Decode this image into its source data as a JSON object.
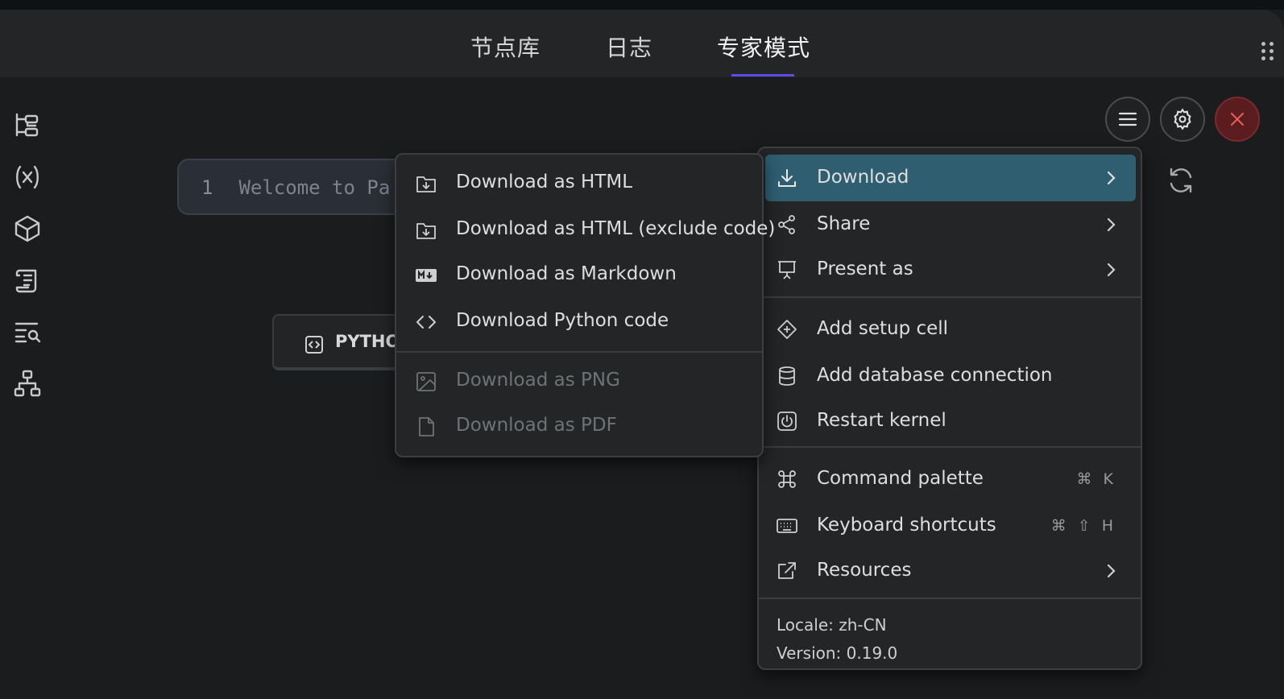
{
  "tabs": [
    {
      "label": "节点库",
      "active": false
    },
    {
      "label": "日志",
      "active": false
    },
    {
      "label": "专家模式",
      "active": true
    }
  ],
  "colors": {
    "accent": "#5b4ee8",
    "highlight": "#2f5e70",
    "close": "#e05a5a"
  },
  "sidebar": {
    "icons": [
      "tree-icon",
      "variables-icon",
      "package-icon",
      "scroll-icon",
      "search-list-icon",
      "hierarchy-icon"
    ]
  },
  "editor": {
    "line_number": "1",
    "line_text": "Welcome to Pa"
  },
  "python_button": {
    "label": "PYTHO"
  },
  "main_menu": {
    "items": [
      {
        "label": "Download",
        "icon": "download-icon",
        "submenu": true,
        "highlighted": true
      },
      {
        "label": "Share",
        "icon": "share-icon",
        "submenu": true
      },
      {
        "label": "Present as",
        "icon": "presentation-icon",
        "submenu": true
      },
      {
        "label": "Add setup cell",
        "icon": "diamond-plus-icon"
      },
      {
        "label": "Add database connection",
        "icon": "database-icon"
      },
      {
        "label": "Restart kernel",
        "icon": "power-icon"
      },
      {
        "label": "Command palette",
        "icon": "command-icon",
        "shortcut": "⌘ K"
      },
      {
        "label": "Keyboard shortcuts",
        "icon": "keyboard-icon",
        "shortcut": "⌘ ⇧ H"
      },
      {
        "label": "Resources",
        "icon": "external-link-icon",
        "submenu": true
      }
    ],
    "locale": "Locale: zh-CN",
    "version": "Version: 0.19.0"
  },
  "download_menu": {
    "items": [
      {
        "label": "Download as HTML",
        "icon": "folder-download-icon",
        "enabled": true
      },
      {
        "label": "Download as HTML (exclude code)",
        "icon": "folder-download-icon",
        "enabled": true
      },
      {
        "label": "Download as Markdown",
        "icon": "markdown-icon",
        "enabled": true
      },
      {
        "label": "Download Python code",
        "icon": "code-icon",
        "enabled": true
      },
      {
        "label": "Download as PNG",
        "icon": "image-icon",
        "enabled": false
      },
      {
        "label": "Download as PDF",
        "icon": "file-icon",
        "enabled": false
      }
    ]
  }
}
